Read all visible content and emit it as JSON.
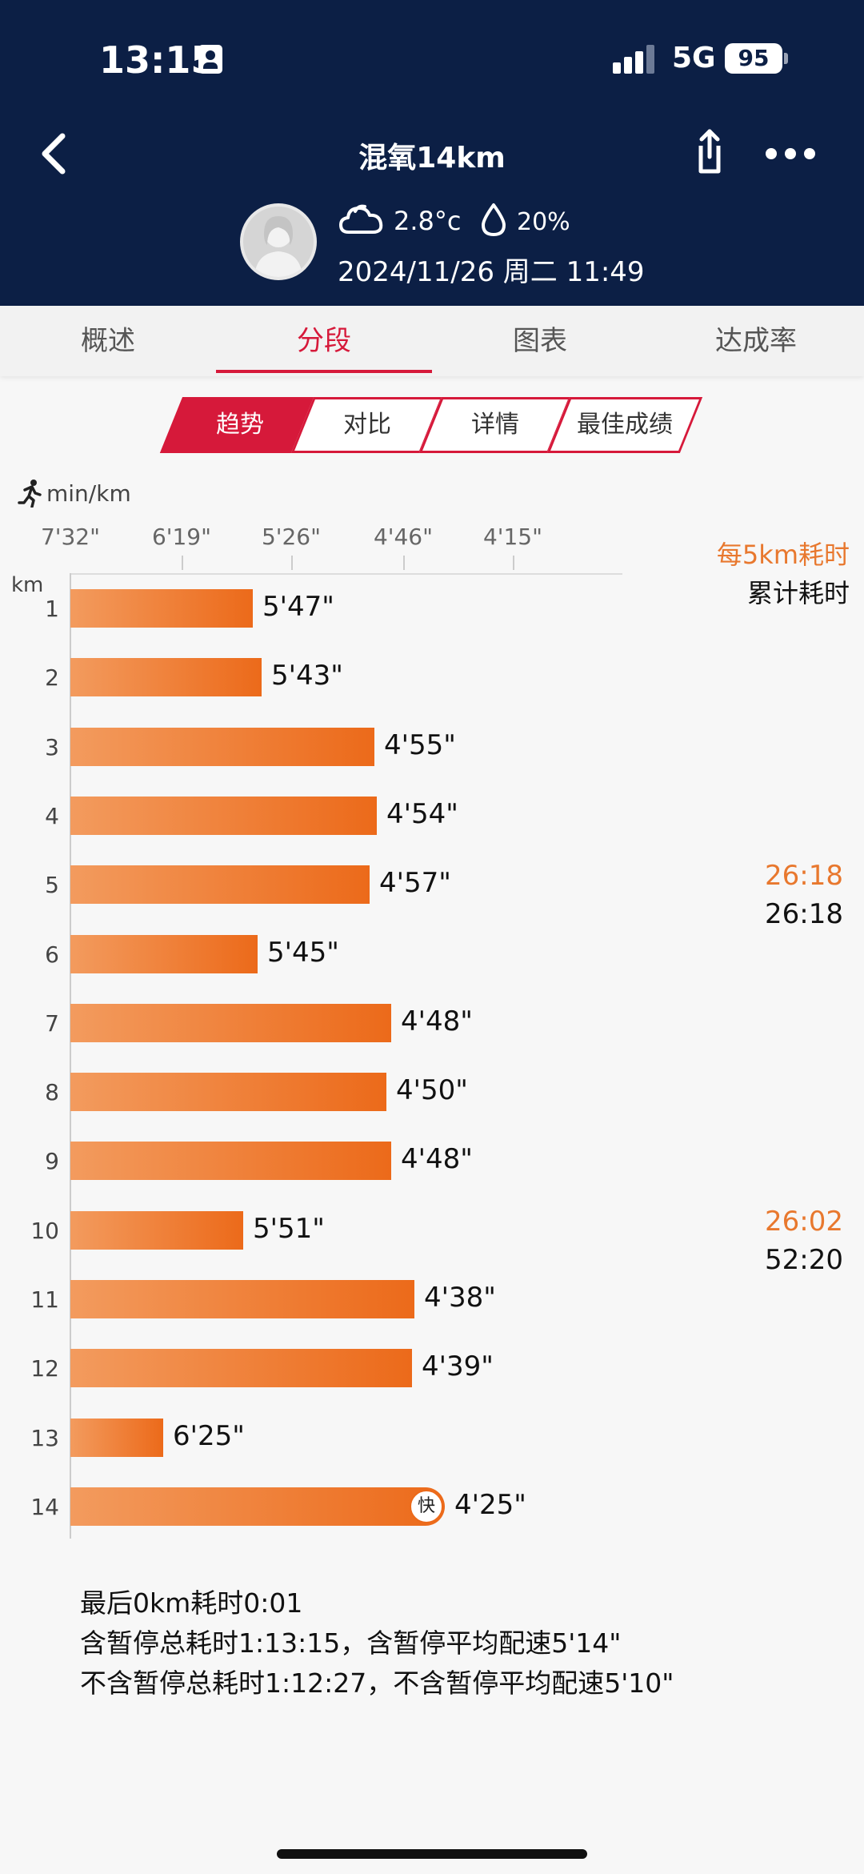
{
  "status_bar": {
    "time": "13:15",
    "network": "5G",
    "battery": "95"
  },
  "header": {
    "title": "混氧14km",
    "weather": {
      "temp": "2.8°c",
      "humidity": "20%"
    },
    "datetime": "2024/11/26 周二 11:49"
  },
  "tabs": [
    "概述",
    "分段",
    "图表",
    "达成率"
  ],
  "active_tab": 1,
  "segments": [
    "趋势",
    "对比",
    "详情",
    "最佳成绩"
  ],
  "active_segment": 0,
  "chart": {
    "unit": "min/km",
    "km_label": "km",
    "ticks": [
      "7'32\"",
      "6'19\"",
      "5'26\"",
      "4'46\"",
      "4'15\""
    ],
    "five_km_title": "每5km耗时",
    "cumulative_title": "累计耗时",
    "fast_badge": "快",
    "splits_5km": [
      {
        "five": "26:18",
        "cumulative": "26:18"
      },
      {
        "five": "26:02",
        "cumulative": "52:20"
      }
    ]
  },
  "chart_data": {
    "type": "bar",
    "orientation": "horizontal",
    "categories": [
      "1",
      "2",
      "3",
      "4",
      "5",
      "6",
      "7",
      "8",
      "9",
      "10",
      "11",
      "12",
      "13",
      "14"
    ],
    "labels": [
      "5'47\"",
      "5'43\"",
      "4'55\"",
      "4'54\"",
      "4'57\"",
      "5'45\"",
      "4'48\"",
      "4'50\"",
      "4'48\"",
      "5'51\"",
      "4'38\"",
      "4'39\"",
      "6'25\"",
      "4'25\""
    ],
    "values_seconds_per_km": [
      347,
      343,
      295,
      294,
      297,
      345,
      288,
      290,
      288,
      351,
      278,
      279,
      385,
      265
    ],
    "fastest_index": 13,
    "axis_ticks": [
      "7'32\"",
      "6'19\"",
      "5'26\"",
      "4'46\"",
      "4'15\""
    ],
    "axis_ticks_seconds": [
      452,
      379,
      326,
      286,
      255
    ],
    "ylabel": "km",
    "xlabel": "min/km",
    "colors": {
      "bar_start": "#f39b5e",
      "bar_end": "#ec6a1a",
      "accent": "#d6193a"
    }
  },
  "summary": {
    "line1": "最后0km耗时0:01",
    "line2": "含暂停总耗时1:13:15，含暂停平均配速5'14\"",
    "line3": "不含暂停总耗时1:12:27，不含暂停平均配速5'10\""
  }
}
